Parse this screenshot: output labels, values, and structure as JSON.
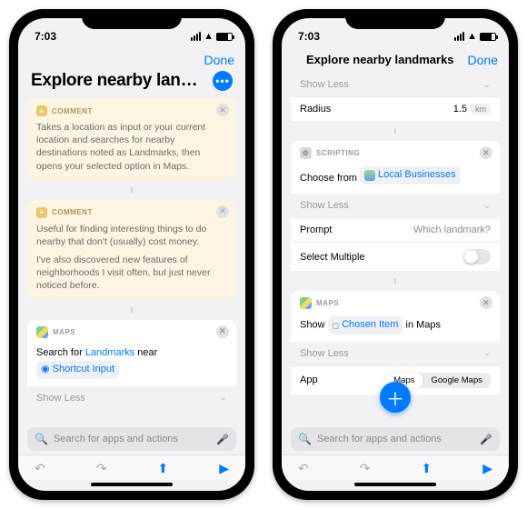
{
  "status": {
    "time": "7:03"
  },
  "nav": {
    "done": "Done",
    "center_title": "Explore nearby landmarks"
  },
  "left": {
    "title": "Explore nearby landma...",
    "comment_label": "COMMENT",
    "comment1": "Takes a location as input or your current location and searches for nearby destinations noted as Landmarks, then opens your selected option in Maps.",
    "comment2a": "Useful for finding interesting things to do nearby that don't (usually) cost money.",
    "comment2b": "I've also discovered new features of neighborhoods I visit often, but just never noticed before.",
    "maps_label": "MAPS",
    "search_for": "Search for",
    "landmarks_tok": "Landmarks",
    "near": "near",
    "shortcut_input": "Shortcut Input",
    "show_less": "Show Less"
  },
  "right": {
    "show_less": "Show Less",
    "radius_label": "Radius",
    "radius_val": "1.5",
    "radius_unit": "km",
    "scripting_label": "SCRIPTING",
    "choose_from": "Choose from",
    "local_biz": "Local Businesses",
    "prompt_label": "Prompt",
    "prompt_val": "Which landmark?",
    "select_multiple": "Select Multiple",
    "maps_label": "MAPS",
    "show": "Show",
    "chosen_item": "Chosen Item",
    "in_maps": "in Maps",
    "app_label": "App",
    "seg_maps": "Maps",
    "seg_gmaps": "Google Maps"
  },
  "search": {
    "placeholder": "Search for apps and actions"
  }
}
